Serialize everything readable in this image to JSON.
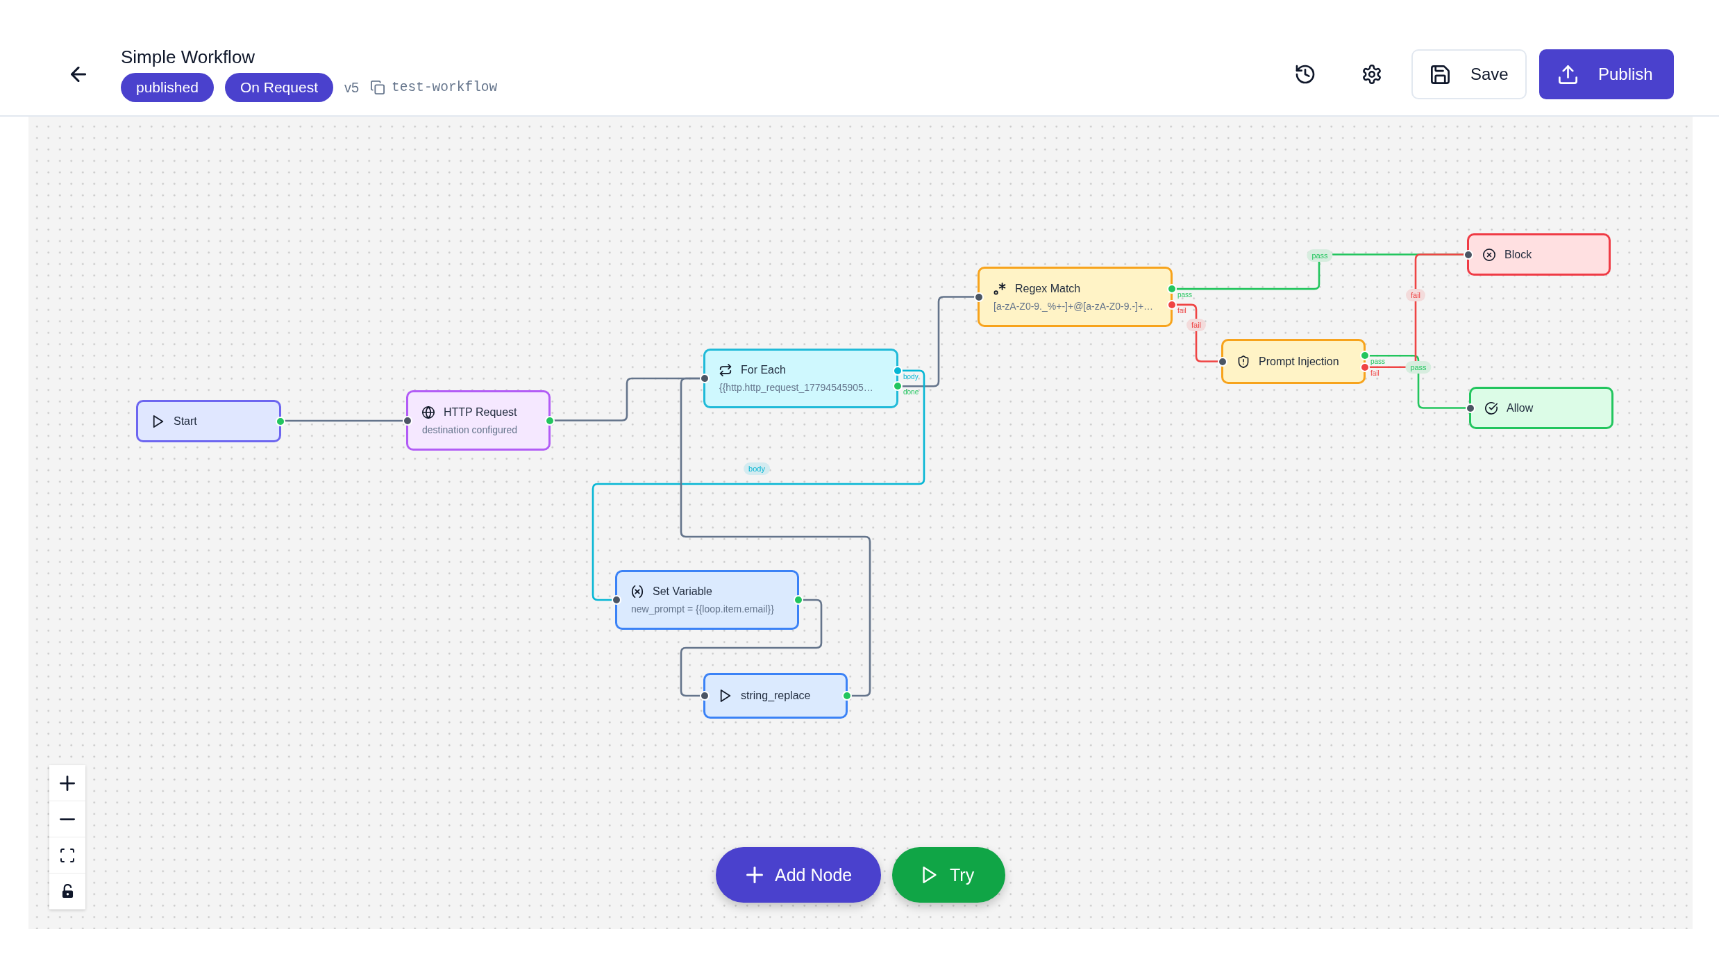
{
  "header": {
    "title": "Simple Workflow",
    "badges": [
      "published",
      "On Request"
    ],
    "version": "v5",
    "slug": "test-workflow",
    "buttons": [
      {
        "kind": "save",
        "label": "Save"
      },
      {
        "kind": "publish",
        "label": "Publish"
      }
    ]
  },
  "canvas": {
    "nodes": [
      {
        "kind": "trigger",
        "title": "Start",
        "input": false,
        "outputs": [
          {
            "color": "#22c55e"
          }
        ]
      },
      {
        "kind": "http",
        "title": "HTTP Request",
        "subtitle": "destination configured",
        "input": true,
        "outputs": [
          {
            "color": "#22c55e"
          }
        ]
      },
      {
        "kind": "loop",
        "title": "For Each",
        "subtitle": "{{http.http_request_17794545905…",
        "input": true,
        "outputs": [
          {
            "label": "body",
            "color": "#06b6d4"
          },
          {
            "label": "done",
            "color": "#22c55e"
          }
        ]
      },
      {
        "kind": "regex",
        "title": "Regex Match",
        "subtitle": "[a-zA-Z0-9._%+-]+@[a-zA-Z0-9.-]+…",
        "input": true,
        "outputs": [
          {
            "label": "pass",
            "color": "#22c55e"
          },
          {
            "label": "fail",
            "color": "#ef4444"
          }
        ]
      },
      {
        "kind": "guard",
        "title": "Prompt Injection",
        "input": true,
        "outputs": [
          {
            "label": "pass",
            "color": "#22c55e"
          },
          {
            "label": "fail",
            "color": "#ef4444"
          }
        ]
      },
      {
        "kind": "block",
        "title": "Block",
        "input": true
      },
      {
        "kind": "allow",
        "title": "Allow",
        "input": true
      },
      {
        "kind": "variable",
        "title": "Set Variable",
        "subtitle": "new_prompt = {{loop.item.email}}",
        "input": true,
        "outputs": [
          {
            "color": "#22c55e"
          }
        ]
      },
      {
        "kind": "function",
        "title": "string_replace",
        "input": true,
        "outputs": [
          {
            "color": "#22c55e"
          }
        ]
      }
    ],
    "edges": [
      {
        "color": "#64748b"
      },
      {
        "color": "#64748b"
      },
      {
        "color": "#64748b"
      },
      {
        "label": "body",
        "color": "#06b6d4"
      },
      {
        "color": "#64748b"
      },
      {
        "color": "#64748b"
      },
      {
        "label": "pass",
        "color": "#22c55e"
      },
      {
        "label": "fail",
        "color": "#ef4444"
      },
      {
        "label": "pass",
        "color": "#22c55e"
      },
      {
        "label": "fail",
        "color": "#ef4444"
      }
    ]
  },
  "actions": [
    {
      "kind": "add",
      "label": "Add Node"
    },
    {
      "kind": "run",
      "label": "Try"
    }
  ]
}
